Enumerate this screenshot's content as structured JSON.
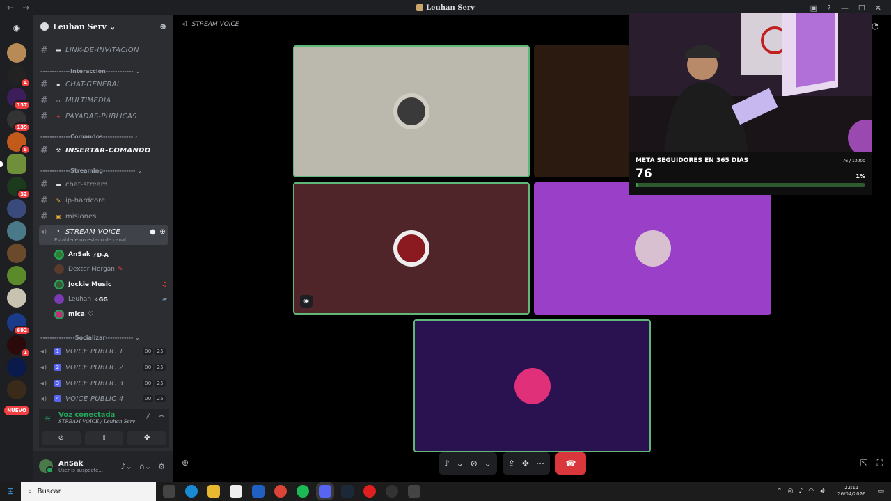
{
  "window": {
    "title": "Leuhan Serv",
    "nav_back": "←",
    "nav_fwd": "→"
  },
  "guilds": [
    {
      "badge": ""
    },
    {
      "badge": "4"
    },
    {
      "badge": "137"
    },
    {
      "badge": "139"
    },
    {
      "badge": "5"
    },
    {
      "badge": ""
    },
    {
      "badge": "32"
    },
    {
      "badge": ""
    },
    {
      "badge": ""
    },
    {
      "badge": ""
    },
    {
      "badge": ""
    },
    {
      "badge": ""
    },
    {
      "badge": "692"
    },
    {
      "badge": "1"
    },
    {
      "badge": ""
    }
  ],
  "guild_new_label": "NUEVO",
  "server": {
    "name": "Leuhan Serv",
    "categories": {
      "interaccion": "-------------Interaccion------------ ⌄",
      "comandos": "-------------Comandos------------- ›",
      "streaming": "-------------Streaming-------------- ⌄",
      "socializar": "---------------Socializar------------ ⌄"
    },
    "channels": {
      "link": "LINK-DE-INVITACION",
      "chat_general": "CHAT-GENERAL",
      "multimedia": "MULTIMEDIA",
      "payadas": "PAYADAS-PUBLICAS",
      "insertar": "INSERTAR-COMANDO",
      "chat_stream": "chat-stream",
      "ip_hardcore": "ip-hardcore",
      "misiones": "misiones",
      "stream_voice": "STREAM VOICE",
      "stream_voice_status": "Establece un estado de canal",
      "voice1": "VOICE PUBLIC 1",
      "voice2": "VOICE PUBLIC 2",
      "voice3": "VOICE PUBLIC 3",
      "voice4": "VOICE PUBLIC 4",
      "count_a": "00",
      "count_b": "25"
    },
    "members": {
      "m1": "AnSak",
      "m1_tag": "⚡D-A",
      "m2": "Dexter Morgan",
      "m3": "Jockie Music",
      "m4": "Leuhan",
      "m4_tag": "✧GG",
      "m5": "mica_♡"
    }
  },
  "voice_panel": {
    "status": "Voz conectada",
    "location": "STREAM VOICE / Leuhan Serv"
  },
  "user": {
    "name": "AnSak",
    "status": "User is suspecte..."
  },
  "stage": {
    "title": "STREAM VOICE"
  },
  "goal_overlay": {
    "title": "META SEGUIDORES EN 365 DIAS",
    "current": "76",
    "progress_text": "76 / 10000",
    "percent_text": "1%",
    "fraction": 0.0076
  },
  "taskbar": {
    "search_placeholder": "Buscar",
    "time": "22:11",
    "date": "26/04/2026"
  },
  "colors": {
    "accent": "#5865f2",
    "speaking": "#5fb77a",
    "hangup": "#da373c",
    "tile_gray": "#bbb8ae",
    "tile_maroon": "#4f2529",
    "tile_purple": "#9a40c8",
    "tile_indigo": "#2a1250"
  }
}
